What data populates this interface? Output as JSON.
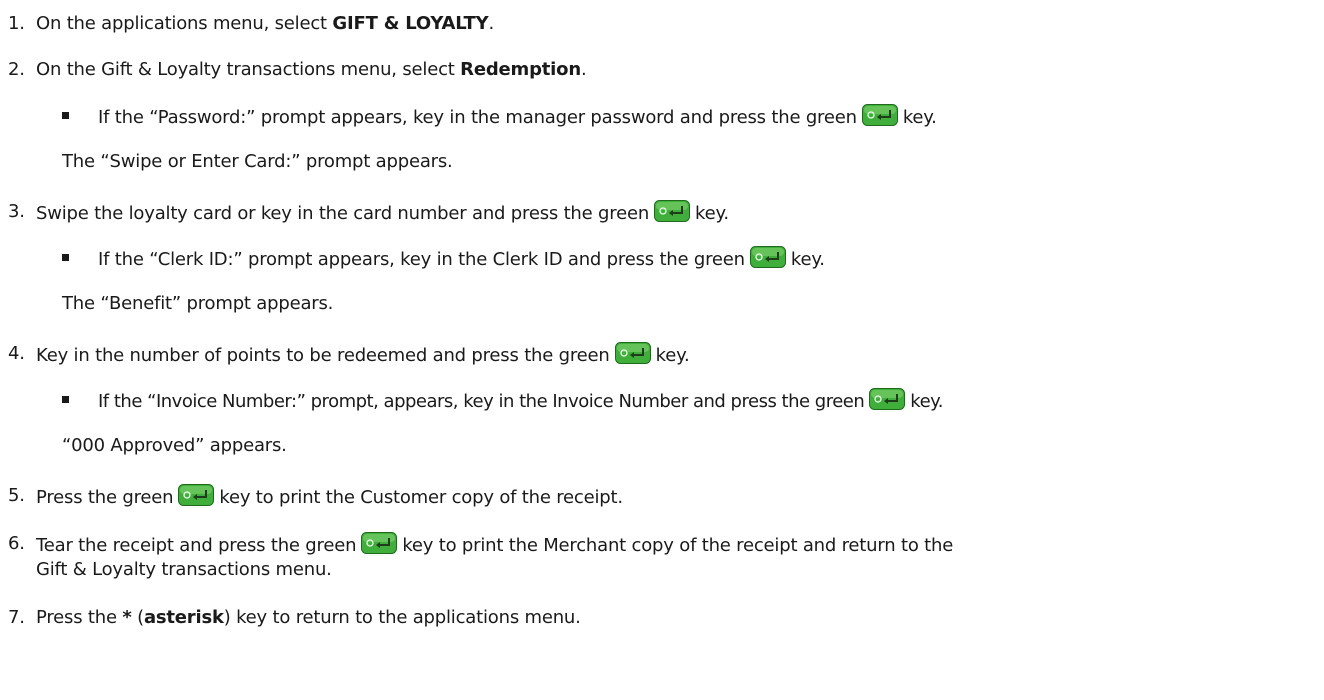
{
  "steps": [
    {
      "num": "1.",
      "pre": "On the applications menu, select ",
      "bold": "GIFT & LOYALTY",
      "post": "."
    },
    {
      "num": "2.",
      "pre": "On the Gift & Loyalty transactions menu, select ",
      "bold": "Redemption",
      "post": "."
    },
    {
      "bullet_a": {
        "pre": "If the “Password:” prompt appears, key in the manager password and press the green",
        "post": "key."
      }
    },
    {
      "note_a": "The “Swipe or Enter Card:” prompt appears."
    },
    {
      "num": "3.",
      "pre": "Swipe the loyalty card or key in the card number and press the green",
      "post": "key."
    },
    {
      "bullet_b": {
        "pre": "If the “Clerk ID:” prompt appears, key in the Clerk ID and press the green",
        "post": "key."
      }
    },
    {
      "note_b": "The “Benefit” prompt appears."
    },
    {
      "num": "4.",
      "pre": "Key in the number of points to be redeemed and press the green",
      "post": "key."
    },
    {
      "bullet_c": {
        "pre": "If the “Invoice Number:” prompt, appears, key in the Invoice Number and press the green",
        "post": "key."
      }
    },
    {
      "note_c": "“000 Approved” appears."
    },
    {
      "num": "5.",
      "pre": "Press the green",
      "post": "key to print the Customer copy of the receipt."
    },
    {
      "num": "6.",
      "pre": "Tear the receipt and press the green",
      "post": "key to print the Merchant copy of the receipt and return to the",
      "cont": "Gift & Loyalty transactions menu."
    },
    {
      "num": "7.",
      "pre": "Press the ",
      "bold": "*",
      "mid": " (",
      "bold2": "asterisk",
      "post": ") key to return to the applications menu."
    }
  ],
  "icons": {
    "enter_key": "green-enter-key-icon"
  },
  "colors": {
    "key_green": "#3fae3a",
    "key_dark": "#1f6b1c",
    "text": "#1a1a1a"
  }
}
